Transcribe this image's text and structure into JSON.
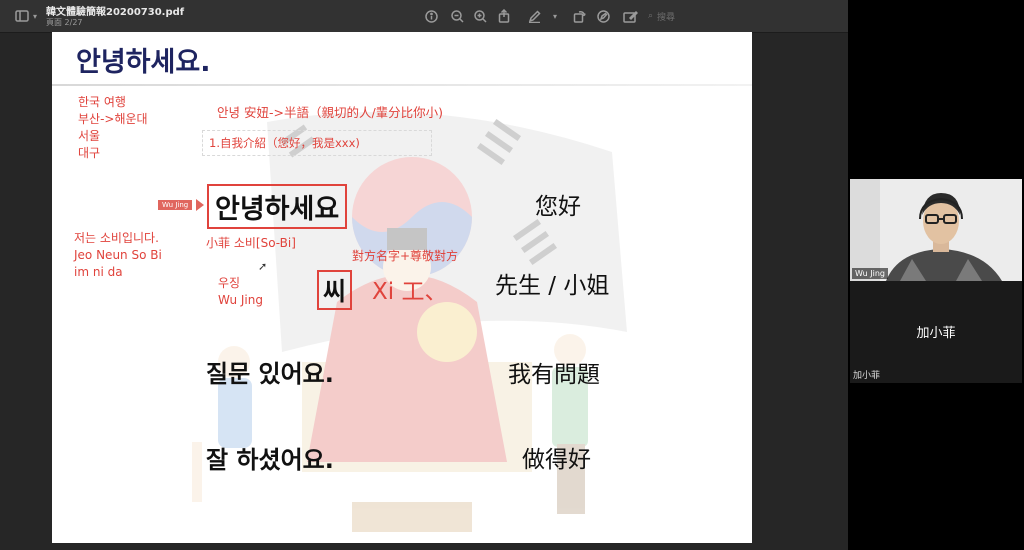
{
  "toolbar": {
    "filename": "韓文體驗簡報20200730.pdf",
    "page_info": "頁面 2/27",
    "search_placeholder": "搜尋",
    "icons": [
      "sidebar-icon",
      "chevron-down-icon",
      "info-icon",
      "zoom-out-icon",
      "zoom-in-icon",
      "share-icon",
      "pen-icon",
      "chevron-down-icon",
      "rotate-icon",
      "markup-icon",
      "annotate-icon",
      "search-icon"
    ]
  },
  "slide": {
    "title": "안녕하세요.",
    "topics": [
      "한국 여행",
      "부산->해운대",
      "서울",
      "대구"
    ],
    "header_note": "안녕 安妞->半語（親切的人/輩分比你小)",
    "intro_note": "1.自我介紹（您好，我是xxx)",
    "arrow_label": "Wu Jing",
    "greeting_ko": "안녕하세요",
    "greeting_zh": "您好",
    "self_intro": [
      "저는 소비입니다.",
      "Jeo Neun So Bi",
      "im ni da"
    ],
    "name_sobi": "小菲 소비[So-Bi]",
    "honorific_note": "對方名字+尊敬對方",
    "name_wujing": [
      "우징",
      "Wu Jing"
    ],
    "ssi": "씨",
    "ssi_hand": "Xi 工、",
    "ssi_zh": "先生 / 小姐",
    "question_ko": "질문 있어요.",
    "question_zh": "我有問題",
    "welldone_ko": "잘 하셨어요.",
    "welldone_zh": "做得好"
  },
  "video": {
    "camera_name": "Wu Jing",
    "tile_name": "加小菲",
    "tile_label": "加小菲"
  },
  "colors": {
    "title_navy": "#1e2460",
    "annotation_red": "#e0433c"
  }
}
